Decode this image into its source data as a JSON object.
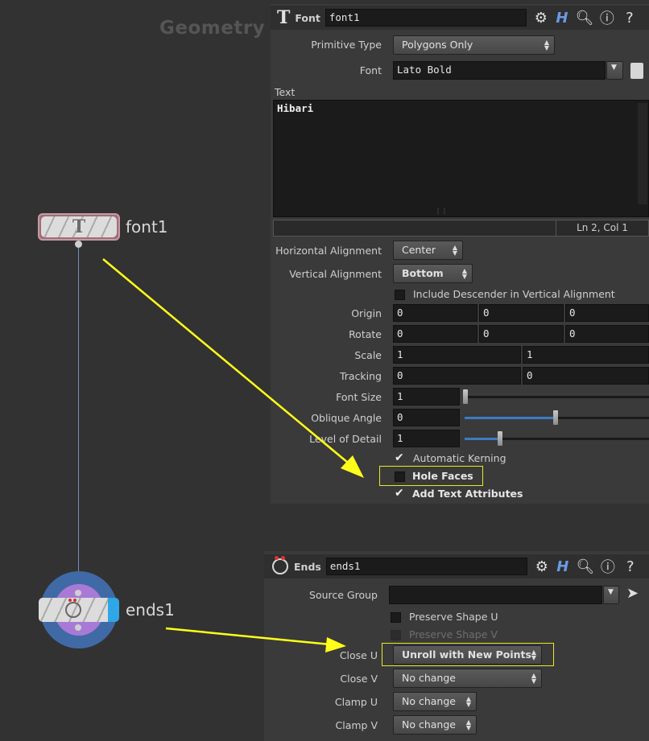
{
  "network": {
    "title": "Geometry",
    "nodes": {
      "font1": {
        "label": "font1"
      },
      "ends1": {
        "label": "ends1"
      }
    }
  },
  "font_panel": {
    "type_label": "Font",
    "node_name": "font1",
    "primitive_type_label": "Primitive Type",
    "primitive_type_value": "Polygons Only",
    "font_label": "Font",
    "font_value": "Lato Bold",
    "text_label": "Text",
    "text_value": "Hibari",
    "cursor_status": "Ln 2, Col 1",
    "h_align_label": "Horizontal Alignment",
    "h_align_value": "Center",
    "v_align_label": "Vertical Alignment",
    "v_align_value": "Bottom",
    "descender_label": "Include Descender in Vertical Alignment",
    "origin_label": "Origin",
    "origin": [
      "0",
      "0",
      "0"
    ],
    "rotate_label": "Rotate",
    "rotate": [
      "0",
      "0",
      "0"
    ],
    "scale_label": "Scale",
    "scale": [
      "1",
      "1"
    ],
    "tracking_label": "Tracking",
    "tracking": [
      "0",
      "0"
    ],
    "font_size_label": "Font Size",
    "font_size": "1",
    "oblique_label": "Oblique Angle",
    "oblique": "0",
    "lod_label": "Level of Detail",
    "lod": "1",
    "kerning_label": "Automatic Kerning",
    "kerning_checked": true,
    "hole_faces_label": "Hole Faces",
    "hole_faces_checked": false,
    "add_text_attr_label": "Add Text Attributes",
    "add_text_attr_checked": true
  },
  "ends_panel": {
    "type_label": "Ends",
    "node_name": "ends1",
    "source_group_label": "Source Group",
    "source_group_value": "",
    "preserve_u_label": "Preserve Shape U",
    "preserve_v_label": "Preserve Shape V",
    "close_u_label": "Close U",
    "close_u_value": "Unroll with New Points",
    "close_v_label": "Close V",
    "close_v_value": "No change",
    "clamp_u_label": "Clamp U",
    "clamp_u_value": "No change",
    "clamp_v_label": "Clamp V",
    "clamp_v_value": "No change"
  },
  "colors": {
    "highlight": "#e8e82a",
    "arrow": "#ffff1a",
    "wire": "#6f8fb6",
    "ends_node_ring": "#3f6aa6",
    "ends_node_inner": "#a87ad6"
  }
}
